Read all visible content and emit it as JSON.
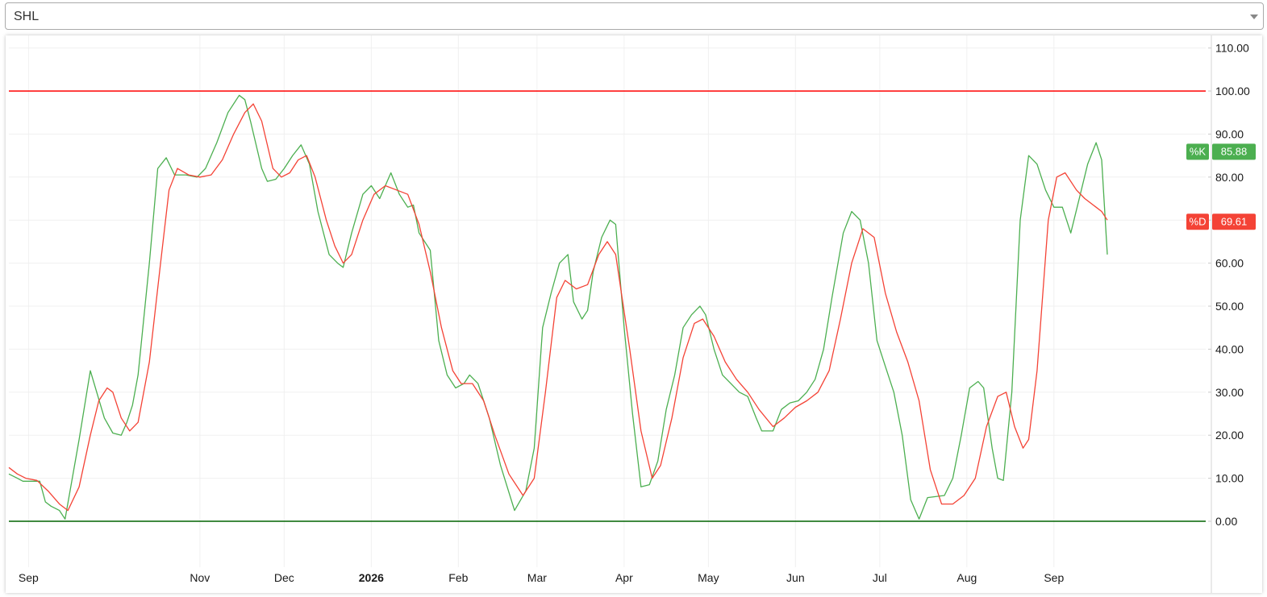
{
  "symbol": {
    "value": "SHL"
  },
  "colors": {
    "k_line": "#4caf50",
    "d_line": "#f44336",
    "overbought_line": "#ff0000",
    "oversold_line": "#006400",
    "grid": "#f0f0f0",
    "text": "#191919"
  },
  "badges": {
    "k": {
      "label": "%K",
      "value": "85.88"
    },
    "d": {
      "label": "%D",
      "value": "69.61"
    }
  },
  "chart_data": {
    "type": "line",
    "title": "",
    "ylim": [
      -12,
      110
    ],
    "grid": true,
    "y_ticks": [
      "110.00",
      "100.00",
      "90.00",
      "80.00",
      "70.00",
      "60.00",
      "50.00",
      "40.00",
      "30.00",
      "20.00",
      "10.00",
      "0.00"
    ],
    "y_tick_values": [
      110,
      100,
      90,
      80,
      70,
      60,
      50,
      40,
      30,
      20,
      10,
      0
    ],
    "x_range": [
      "2025-08-25",
      "2026-09-20"
    ],
    "x_ticks": [
      {
        "label": "Sep",
        "date": "2025-09-01",
        "bold": false
      },
      {
        "label": "Nov",
        "date": "2025-11-01",
        "bold": false
      },
      {
        "label": "Dec",
        "date": "2025-12-01",
        "bold": false
      },
      {
        "label": "2026",
        "date": "2026-01-01",
        "bold": true
      },
      {
        "label": "Feb",
        "date": "2026-02-01",
        "bold": false
      },
      {
        "label": "Mar",
        "date": "2026-03-01",
        "bold": false
      },
      {
        "label": "Apr",
        "date": "2026-04-01",
        "bold": false
      },
      {
        "label": "May",
        "date": "2026-05-01",
        "bold": false
      },
      {
        "label": "Jun",
        "date": "2026-06-01",
        "bold": false
      },
      {
        "label": "Jul",
        "date": "2026-07-01",
        "bold": false
      },
      {
        "label": "Aug",
        "date": "2026-08-01",
        "bold": false
      },
      {
        "label": "Sep",
        "date": "2026-09-01",
        "bold": false
      }
    ],
    "reference_lines": [
      {
        "value": 100,
        "color": "#ff0000"
      },
      {
        "value": 0,
        "color": "#006400"
      }
    ],
    "series": [
      {
        "name": "%K",
        "color": "#4caf50",
        "points": [
          [
            "2025-08-25",
            11
          ],
          [
            "2025-08-28",
            10
          ],
          [
            "2025-08-30",
            9.3
          ],
          [
            "2025-09-05",
            9.3
          ],
          [
            "2025-09-07",
            4.5
          ],
          [
            "2025-09-09",
            3.5
          ],
          [
            "2025-09-12",
            2.5
          ],
          [
            "2025-09-14",
            0.5
          ],
          [
            "2025-09-19",
            19
          ],
          [
            "2025-09-23",
            35
          ],
          [
            "2025-09-28",
            24
          ],
          [
            "2025-10-01",
            20.5
          ],
          [
            "2025-10-04",
            20
          ],
          [
            "2025-10-06",
            23
          ],
          [
            "2025-10-08",
            27
          ],
          [
            "2025-10-10",
            34
          ],
          [
            "2025-10-14",
            60
          ],
          [
            "2025-10-17",
            82
          ],
          [
            "2025-10-20",
            84.5
          ],
          [
            "2025-10-23",
            80.5
          ],
          [
            "2025-10-27",
            80.5
          ],
          [
            "2025-10-31",
            80
          ],
          [
            "2025-11-03",
            82
          ],
          [
            "2025-11-07",
            88
          ],
          [
            "2025-11-11",
            95
          ],
          [
            "2025-11-15",
            99
          ],
          [
            "2025-11-17",
            98
          ],
          [
            "2025-11-19",
            93
          ],
          [
            "2025-11-23",
            82
          ],
          [
            "2025-11-25",
            79
          ],
          [
            "2025-11-28",
            79.5
          ],
          [
            "2025-12-01",
            82
          ],
          [
            "2025-12-04",
            85
          ],
          [
            "2025-12-07",
            87.5
          ],
          [
            "2025-12-10",
            83
          ],
          [
            "2025-12-13",
            72
          ],
          [
            "2025-12-17",
            62
          ],
          [
            "2025-12-20",
            60
          ],
          [
            "2025-12-22",
            59
          ],
          [
            "2025-12-25",
            67
          ],
          [
            "2025-12-29",
            76
          ],
          [
            "2026-01-01",
            78
          ],
          [
            "2026-01-04",
            75
          ],
          [
            "2026-01-08",
            81
          ],
          [
            "2026-01-11",
            76
          ],
          [
            "2026-01-14",
            73
          ],
          [
            "2026-01-16",
            73.5
          ],
          [
            "2026-01-18",
            67
          ],
          [
            "2026-01-22",
            63
          ],
          [
            "2026-01-25",
            42
          ],
          [
            "2026-01-28",
            34
          ],
          [
            "2026-01-31",
            31
          ],
          [
            "2026-02-03",
            32
          ],
          [
            "2026-02-05",
            34
          ],
          [
            "2026-02-08",
            32
          ],
          [
            "2026-02-12",
            24
          ],
          [
            "2026-02-16",
            13
          ],
          [
            "2026-02-21",
            2.5
          ],
          [
            "2026-02-25",
            7
          ],
          [
            "2026-02-28",
            17
          ],
          [
            "2026-03-03",
            45
          ],
          [
            "2026-03-06",
            53
          ],
          [
            "2026-03-09",
            60
          ],
          [
            "2026-03-12",
            62
          ],
          [
            "2026-03-14",
            51
          ],
          [
            "2026-03-17",
            47
          ],
          [
            "2026-03-19",
            49
          ],
          [
            "2026-03-21",
            58
          ],
          [
            "2026-03-24",
            66
          ],
          [
            "2026-03-27",
            70
          ],
          [
            "2026-03-29",
            69
          ],
          [
            "2026-04-01",
            45
          ],
          [
            "2026-04-04",
            25
          ],
          [
            "2026-04-07",
            8
          ],
          [
            "2026-04-10",
            8.5
          ],
          [
            "2026-04-13",
            14
          ],
          [
            "2026-04-16",
            26
          ],
          [
            "2026-04-19",
            34
          ],
          [
            "2026-04-22",
            45
          ],
          [
            "2026-04-25",
            48
          ],
          [
            "2026-04-28",
            50
          ],
          [
            "2026-04-30",
            48
          ],
          [
            "2026-05-03",
            40
          ],
          [
            "2026-05-06",
            34
          ],
          [
            "2026-05-09",
            32
          ],
          [
            "2026-05-12",
            30
          ],
          [
            "2026-05-15",
            29
          ],
          [
            "2026-05-18",
            24
          ],
          [
            "2026-05-20",
            21
          ],
          [
            "2026-05-24",
            21
          ],
          [
            "2026-05-27",
            26
          ],
          [
            "2026-05-30",
            27.5
          ],
          [
            "2026-06-02",
            28
          ],
          [
            "2026-06-05",
            30
          ],
          [
            "2026-06-08",
            33
          ],
          [
            "2026-06-11",
            40
          ],
          [
            "2026-06-14",
            52
          ],
          [
            "2026-06-18",
            67
          ],
          [
            "2026-06-21",
            72
          ],
          [
            "2026-06-24",
            70
          ],
          [
            "2026-06-27",
            60
          ],
          [
            "2026-06-30",
            42
          ],
          [
            "2026-07-03",
            36
          ],
          [
            "2026-07-06",
            30
          ],
          [
            "2026-07-09",
            20
          ],
          [
            "2026-07-12",
            5
          ],
          [
            "2026-07-15",
            0.5
          ],
          [
            "2026-07-18",
            5.5
          ],
          [
            "2026-07-24",
            6
          ],
          [
            "2026-07-27",
            10
          ],
          [
            "2026-07-30",
            20
          ],
          [
            "2026-08-02",
            31
          ],
          [
            "2026-08-05",
            32.5
          ],
          [
            "2026-08-07",
            31
          ],
          [
            "2026-08-10",
            17
          ],
          [
            "2026-08-12",
            10
          ],
          [
            "2026-08-14",
            9.5
          ],
          [
            "2026-08-17",
            30
          ],
          [
            "2026-08-20",
            70
          ],
          [
            "2026-08-23",
            85
          ],
          [
            "2026-08-26",
            83
          ],
          [
            "2026-08-29",
            77
          ],
          [
            "2026-09-01",
            73
          ],
          [
            "2026-09-04",
            73
          ],
          [
            "2026-09-07",
            67
          ],
          [
            "2026-09-10",
            75
          ],
          [
            "2026-09-13",
            83
          ],
          [
            "2026-09-16",
            88
          ],
          [
            "2026-09-18",
            84
          ],
          [
            "2026-09-20",
            62
          ]
        ]
      },
      {
        "name": "%D",
        "color": "#f44336",
        "points": [
          [
            "2025-08-25",
            12.5
          ],
          [
            "2025-08-28",
            11
          ],
          [
            "2025-08-31",
            10
          ],
          [
            "2025-09-04",
            9.5
          ],
          [
            "2025-09-08",
            7
          ],
          [
            "2025-09-12",
            4
          ],
          [
            "2025-09-15",
            2.5
          ],
          [
            "2025-09-19",
            8
          ],
          [
            "2025-09-23",
            20
          ],
          [
            "2025-09-26",
            28
          ],
          [
            "2025-09-29",
            31
          ],
          [
            "2025-10-01",
            30
          ],
          [
            "2025-10-04",
            24
          ],
          [
            "2025-10-07",
            21
          ],
          [
            "2025-10-10",
            23
          ],
          [
            "2025-10-14",
            37
          ],
          [
            "2025-10-18",
            60
          ],
          [
            "2025-10-21",
            77
          ],
          [
            "2025-10-24",
            82
          ],
          [
            "2025-10-28",
            80.5
          ],
          [
            "2025-11-01",
            80
          ],
          [
            "2025-11-05",
            80.5
          ],
          [
            "2025-11-09",
            84
          ],
          [
            "2025-11-13",
            90
          ],
          [
            "2025-11-17",
            95
          ],
          [
            "2025-11-20",
            97
          ],
          [
            "2025-11-23",
            93
          ],
          [
            "2025-11-27",
            82
          ],
          [
            "2025-11-30",
            80
          ],
          [
            "2025-12-03",
            81
          ],
          [
            "2025-12-06",
            84
          ],
          [
            "2025-12-09",
            85
          ],
          [
            "2025-12-12",
            80
          ],
          [
            "2025-12-16",
            70
          ],
          [
            "2025-12-19",
            64
          ],
          [
            "2025-12-22",
            60
          ],
          [
            "2025-12-25",
            62
          ],
          [
            "2025-12-29",
            70
          ],
          [
            "2026-01-02",
            76
          ],
          [
            "2026-01-06",
            78
          ],
          [
            "2026-01-10",
            77
          ],
          [
            "2026-01-14",
            76
          ],
          [
            "2026-01-18",
            69
          ],
          [
            "2026-01-22",
            58
          ],
          [
            "2026-01-26",
            45
          ],
          [
            "2026-01-30",
            35
          ],
          [
            "2026-02-02",
            32
          ],
          [
            "2026-02-06",
            32
          ],
          [
            "2026-02-10",
            28
          ],
          [
            "2026-02-14",
            20
          ],
          [
            "2026-02-19",
            11
          ],
          [
            "2026-02-24",
            6
          ],
          [
            "2026-02-28",
            10
          ],
          [
            "2026-03-04",
            30
          ],
          [
            "2026-03-08",
            52
          ],
          [
            "2026-03-11",
            56
          ],
          [
            "2026-03-15",
            54
          ],
          [
            "2026-03-19",
            55
          ],
          [
            "2026-03-23",
            62
          ],
          [
            "2026-03-26",
            65
          ],
          [
            "2026-03-29",
            62
          ],
          [
            "2026-04-03",
            40
          ],
          [
            "2026-04-07",
            21
          ],
          [
            "2026-04-11",
            10
          ],
          [
            "2026-04-14",
            13
          ],
          [
            "2026-04-18",
            24
          ],
          [
            "2026-04-22",
            38
          ],
          [
            "2026-04-26",
            46
          ],
          [
            "2026-04-29",
            47
          ],
          [
            "2026-05-03",
            43
          ],
          [
            "2026-05-07",
            37
          ],
          [
            "2026-05-11",
            33
          ],
          [
            "2026-05-15",
            30
          ],
          [
            "2026-05-19",
            26
          ],
          [
            "2026-05-24",
            22
          ],
          [
            "2026-05-28",
            24
          ],
          [
            "2026-06-01",
            26.5
          ],
          [
            "2026-06-05",
            28
          ],
          [
            "2026-06-09",
            30
          ],
          [
            "2026-06-13",
            35
          ],
          [
            "2026-06-17",
            47
          ],
          [
            "2026-06-21",
            60
          ],
          [
            "2026-06-25",
            68
          ],
          [
            "2026-06-29",
            66
          ],
          [
            "2026-07-03",
            53
          ],
          [
            "2026-07-07",
            44
          ],
          [
            "2026-07-11",
            37
          ],
          [
            "2026-07-15",
            28
          ],
          [
            "2026-07-19",
            12
          ],
          [
            "2026-07-23",
            4
          ],
          [
            "2026-07-27",
            4
          ],
          [
            "2026-07-31",
            6
          ],
          [
            "2026-08-04",
            10
          ],
          [
            "2026-08-08",
            22
          ],
          [
            "2026-08-12",
            29
          ],
          [
            "2026-08-15",
            30
          ],
          [
            "2026-08-18",
            22
          ],
          [
            "2026-08-21",
            17
          ],
          [
            "2026-08-23",
            19
          ],
          [
            "2026-08-26",
            35
          ],
          [
            "2026-08-30",
            70
          ],
          [
            "2026-09-02",
            80
          ],
          [
            "2026-09-05",
            81
          ],
          [
            "2026-09-09",
            77
          ],
          [
            "2026-09-12",
            75
          ],
          [
            "2026-09-16",
            73
          ],
          [
            "2026-09-18",
            72
          ],
          [
            "2026-09-20",
            70
          ]
        ]
      }
    ]
  }
}
